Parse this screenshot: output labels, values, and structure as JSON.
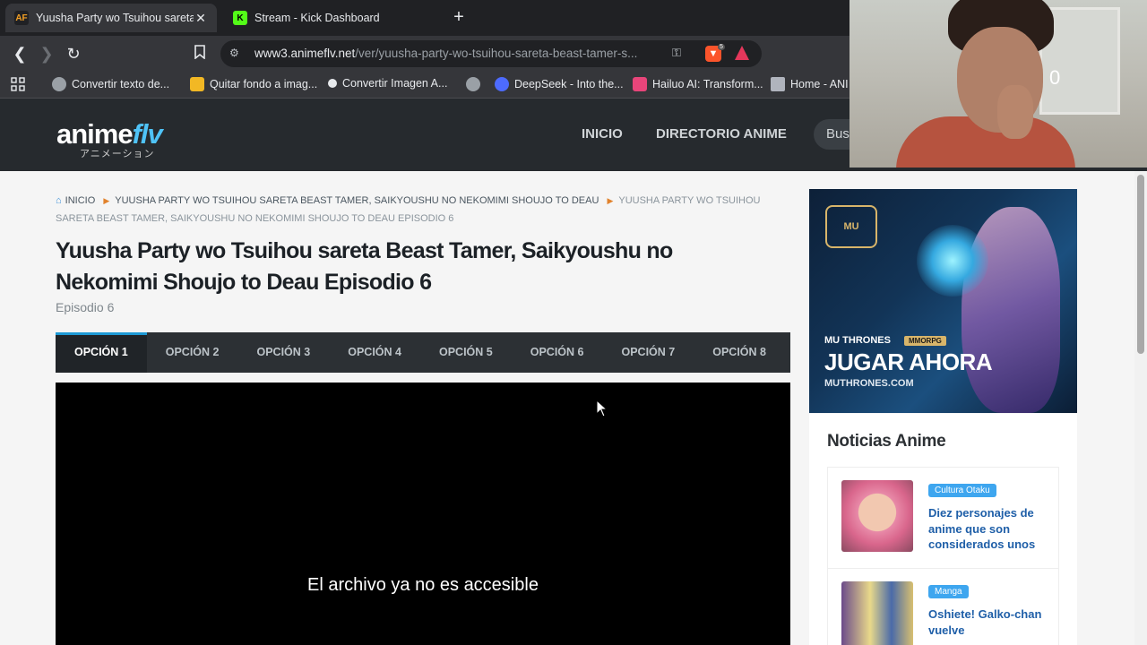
{
  "browser": {
    "tabs": [
      {
        "favicon": "AF",
        "title": "Yuusha Party wo Tsuihou sareta B",
        "active": true
      },
      {
        "favicon": "K",
        "title": "Stream - Kick Dashboard",
        "active": false
      }
    ],
    "new_tab": "+",
    "url_host": "www3.animeflv.net",
    "url_path": "/ver/yuusha-party-wo-tsuihou-sareta-beast-tamer-s...",
    "brave_shield_count": "5",
    "bookmarks": [
      {
        "label": "Convertir texto de...",
        "color": "#9aa0a6"
      },
      {
        "label": "Quitar fondo a imag...",
        "color": "#f2b824"
      },
      {
        "label": "Convertir Imagen A...",
        "color": "#e8eaed"
      },
      {
        "label": "",
        "color": "#9aa0a6"
      },
      {
        "label": "DeepSeek - Into the...",
        "color": "#4d6bfe"
      },
      {
        "label": "Hailuo AI: Transform...",
        "color": "#e8457a"
      },
      {
        "label": "Home - ANI",
        "color": "#b0b4bd"
      }
    ]
  },
  "site": {
    "logo_main": "anime",
    "logo_accent": "flv",
    "logo_sub": "アニメーション",
    "nav": {
      "inicio": "INICIO",
      "directorio": "DIRECTORIO ANIME",
      "search": "Bus"
    }
  },
  "webcam": {
    "counter": "0"
  },
  "breadcrumb": {
    "home": "INICIO",
    "anime": "YUUSHA PARTY WO TSUIHOU SARETA BEAST TAMER, SAIKYOUSHU NO NEKOMIMI SHOUJO TO DEAU",
    "current": "YUUSHA PARTY WO TSUIHOU SARETA BEAST TAMER, SAIKYOUSHU NO NEKOMIMI SHOUJO TO DEAU EPISODIO 6"
  },
  "episode": {
    "title": "Yuusha Party wo Tsuihou sareta Beast Tamer, Saikyoushu no Nekomimi Shoujo to Deau Episodio 6",
    "subtitle": "Episodio 6"
  },
  "options": [
    "OPCIÓN 1",
    "OPCIÓN 2",
    "OPCIÓN 3",
    "OPCIÓN 4",
    "OPCIÓN 5",
    "OPCIÓN 6",
    "OPCIÓN 7",
    "OPCIÓN 8"
  ],
  "player": {
    "message": "El archivo ya no es accesible"
  },
  "ad": {
    "crest": "MU",
    "brand": "MU THRONES",
    "badge": "MMORPG",
    "cta": "JUGAR AHORA",
    "site": "MUTHRONES.COM",
    "accent": "#d8b56a"
  },
  "news": {
    "title": "Noticias Anime",
    "items": [
      {
        "tag": "Cultura Otaku",
        "headline": "Diez personajes de anime que son considerados unos"
      },
      {
        "tag": "Manga",
        "headline": "Oshiete! Galko-chan vuelve"
      }
    ]
  }
}
